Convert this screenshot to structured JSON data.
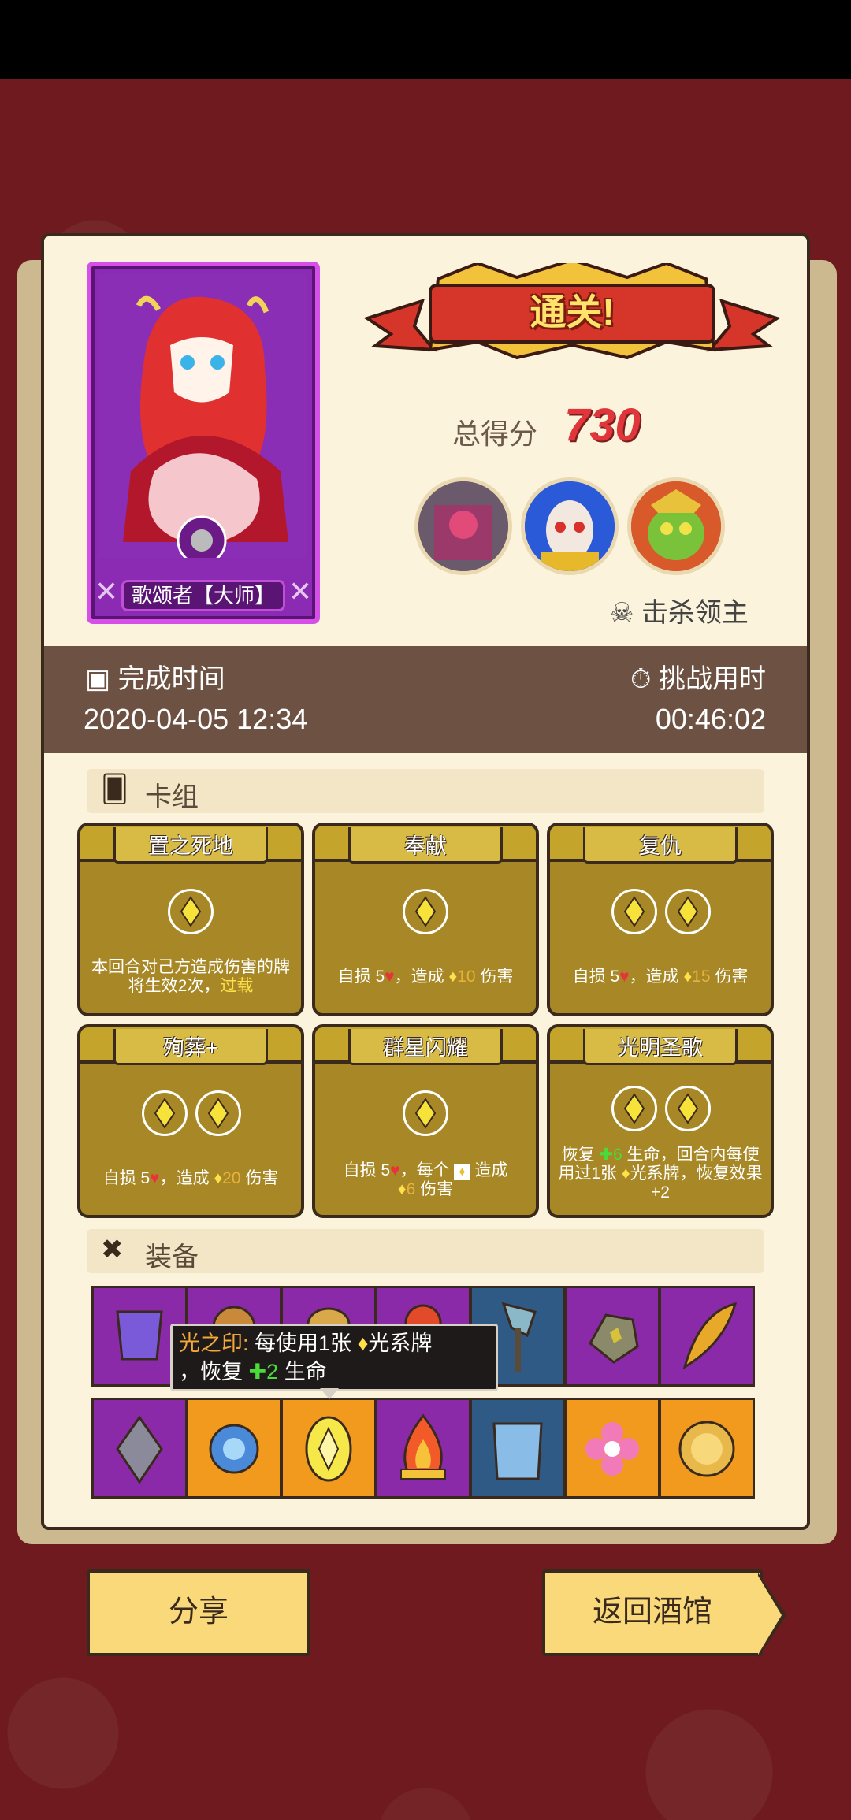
{
  "title": "通关!",
  "score": {
    "label": "总得分",
    "value": "730"
  },
  "hero": {
    "name": "歌颂者【大师】"
  },
  "kill_boss_label": "击杀领主",
  "completion": {
    "label": "完成时间",
    "value": "2020-04-05 12:34"
  },
  "challenge": {
    "label": "挑战用时",
    "value": "00:46:02"
  },
  "deck": {
    "title": "卡组",
    "cards": [
      {
        "name": "置之死地",
        "gems": 1,
        "desc_a": "本回合对己方造成伤害的牌将生效2次，",
        "desc_b": "过载"
      },
      {
        "name": "奉献",
        "gems": 1,
        "desc_a": "自损 5",
        "desc_b": "，造成",
        "desc_c": "10",
        "desc_d": "伤害"
      },
      {
        "name": "复仇",
        "gems": 2,
        "desc_a": "自损 5",
        "desc_b": "，造成",
        "desc_c": "15",
        "desc_d": "伤害"
      },
      {
        "name": "殉葬+",
        "gems": 2,
        "desc_a": "自损 5",
        "desc_b": "，造成",
        "desc_c": "20",
        "desc_d": "伤害"
      },
      {
        "name": "群星闪耀",
        "gems": 1,
        "desc_a": "自损 5",
        "desc_b": "，每个",
        "desc_c": "造成",
        "desc_d": "6",
        "desc_e": "伤害"
      },
      {
        "name": "光明圣歌",
        "gems": 2,
        "desc_a": "恢复",
        "desc_b": "6",
        "desc_c": "生命，回合内每使用过1张",
        "desc_d": "光系牌，恢复效果+2"
      }
    ]
  },
  "equipment": {
    "title": "装备",
    "row1": [
      "purple",
      "purple",
      "purple",
      "purple",
      "blue",
      "purple",
      "purple"
    ],
    "row1_icons": [
      "armor-icon",
      "helmet-icon",
      "hair-icon",
      "flame-orb-icon",
      "axe-icon",
      "stone-icon",
      "feather-icon"
    ],
    "row2": [
      "purple",
      "orange",
      "orange",
      "purple",
      "blue",
      "orange",
      "orange"
    ],
    "row2_icons": [
      "crystal-icon",
      "spiked-orb-icon",
      "light-seal-icon",
      "fire-icon",
      "chest-armor-icon",
      "flower-icon",
      "lion-ring-icon"
    ]
  },
  "tooltip": {
    "name": "光之印:",
    "line1": "每使用1张",
    "line1b": "光系牌",
    "line2a": "，恢复",
    "line2b": "2",
    "line2c": "生命"
  },
  "buttons": {
    "share": "分享",
    "return": "返回酒馆"
  },
  "colors": {
    "background": "#6e1a1e",
    "panel": "#fcf3dc",
    "card": "#a88826",
    "score": "#e0353a"
  }
}
